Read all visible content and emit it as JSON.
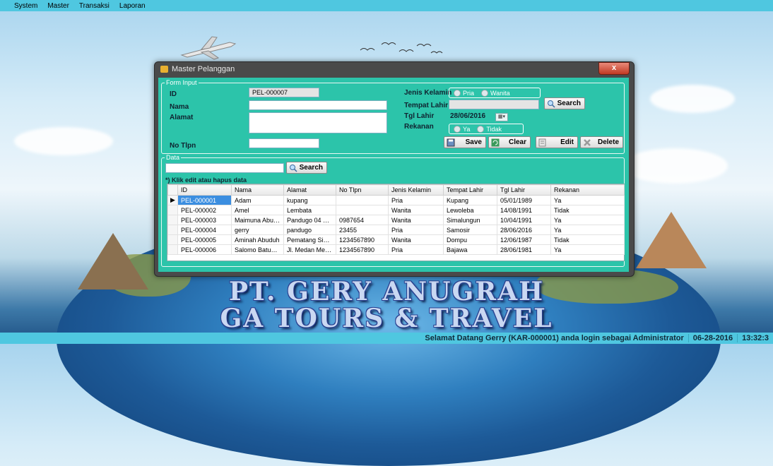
{
  "menu": [
    "System",
    "Master",
    "Transaksi",
    "Laporan"
  ],
  "window": {
    "title": "Master Pelanggan",
    "close": "x"
  },
  "form": {
    "legend": "Form Input",
    "id_label": "ID",
    "id_value": "PEL-000007",
    "nama_label": "Nama",
    "nama_value": "",
    "alamat_label": "Alamat",
    "alamat_value": "",
    "notlpn_label": "No Tlpn",
    "notlpn_value": "",
    "jk_label": "Jenis Kelamin",
    "jk_options": [
      "Pria",
      "Wanita"
    ],
    "tempat_label": "Tempat Lahir",
    "tempat_value": "",
    "tgl_label": "Tgl Lahir",
    "tgl_value": "28/06/2016",
    "rekanan_label": "Rekanan",
    "rekanan_options": [
      "Ya",
      "Tidak"
    ],
    "search_button": "Search",
    "save_button": "Save",
    "clear_button": "Clear",
    "edit_button": "Edit",
    "delete_button": "Delete"
  },
  "data": {
    "legend": "Data",
    "search_value": "",
    "search_button": "Search",
    "hint": "*) Klik edit atau hapus data",
    "columns": [
      "ID",
      "Nama",
      "Alamat",
      "No Tlpn",
      "Jenis Kelamin",
      "Tempat Lahir",
      "Tgl Lahir",
      "Rekanan"
    ],
    "rows": [
      [
        "PEL-000001",
        "Adam",
        "kupang",
        "",
        "Pria",
        "Kupang",
        "05/01/1989",
        "Ya"
      ],
      [
        "PEL-000002",
        "Amel",
        "Lembata",
        "",
        "Wanita",
        "Lewoleba",
        "14/08/1991",
        "Tidak"
      ],
      [
        "PEL-000003",
        "Maimuna Abuba...",
        "Pandugo 04 Sur...",
        "0987654",
        "Wanita",
        "Simalungun",
        "10/04/1991",
        "Ya"
      ],
      [
        "PEL-000004",
        "gerry",
        "pandugo",
        "23455",
        "Pria",
        "Samosir",
        "28/06/2016",
        "Ya"
      ],
      [
        "PEL-000005",
        "Aminah Abuduh",
        "Pematang Siant...",
        "1234567890",
        "Wanita",
        "Dompu",
        "12/06/1987",
        "Tidak"
      ],
      [
        "PEL-000006",
        "Salomo Batubara",
        "Jl. Medan Merd...",
        "1234567890",
        "Pria",
        "Bajawa",
        "28/06/1981",
        "Ya"
      ]
    ]
  },
  "branding": {
    "line1": "PT. GERY ANUGRAH",
    "line2": "GA TOURS & TRAVEL"
  },
  "status": {
    "welcome": "Selamat Datang Gerry (KAR-000001) anda login sebagai Administrator",
    "date": "06-28-2016",
    "time": "13:32:3"
  },
  "colors": {
    "menubar": "#4fc7e0",
    "client": "#2cc4aa",
    "selected_row": "#3b8ee0"
  }
}
